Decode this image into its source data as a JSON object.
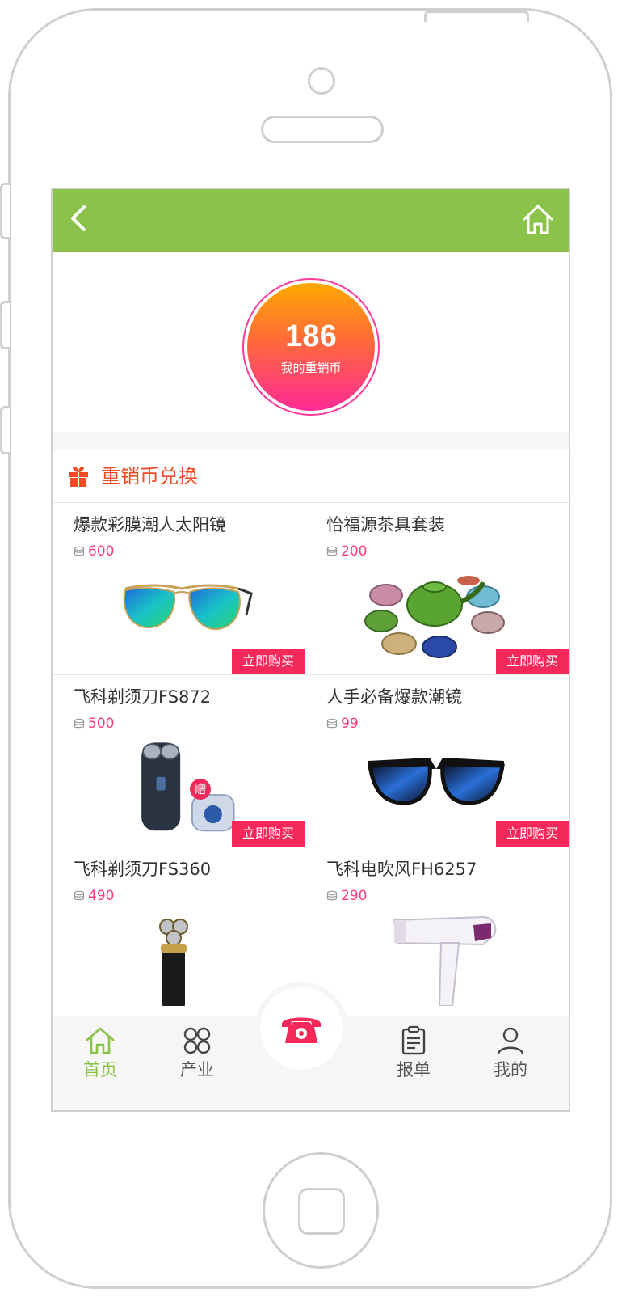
{
  "coins": {
    "value": "186",
    "label": "我的重销币"
  },
  "section": {
    "title": "重销币兑换",
    "icon": "gift-icon"
  },
  "products": [
    {
      "name": "爆款彩膜潮人太阳镜",
      "price": "600",
      "buy_label": "立即购买",
      "image": "aviator-sunglasses"
    },
    {
      "name": "怡福源茶具套装",
      "price": "200",
      "buy_label": "立即购买",
      "image": "tea-set"
    },
    {
      "name": "飞科剃须刀FS872",
      "price": "500",
      "buy_label": "立即购买",
      "image": "electric-shaver",
      "badge": "赠"
    },
    {
      "name": "人手必备爆款潮镜",
      "price": "99",
      "buy_label": "立即购买",
      "image": "square-sunglasses"
    },
    {
      "name": "飞科剃须刀FS360",
      "price": "490",
      "image": "electric-shaver-gold"
    },
    {
      "name": "飞科电吹风FH6257",
      "price": "290",
      "image": "hair-dryer"
    }
  ],
  "nav": {
    "tabs": [
      {
        "label": "首页",
        "icon": "home-icon",
        "active": true
      },
      {
        "label": "产业",
        "icon": "grid-icon"
      },
      {
        "label": "报单",
        "icon": "clipboard-icon"
      },
      {
        "label": "我的",
        "icon": "user-icon"
      }
    ],
    "call_icon": "phone-icon"
  },
  "colors": {
    "header_green": "#8bc34a",
    "accent_red": "#f04a24",
    "buy_pink": "#f5285a",
    "price_pink": "#ff3a7c",
    "coin_gradient": [
      "#ffa800",
      "#ff2a96"
    ]
  }
}
